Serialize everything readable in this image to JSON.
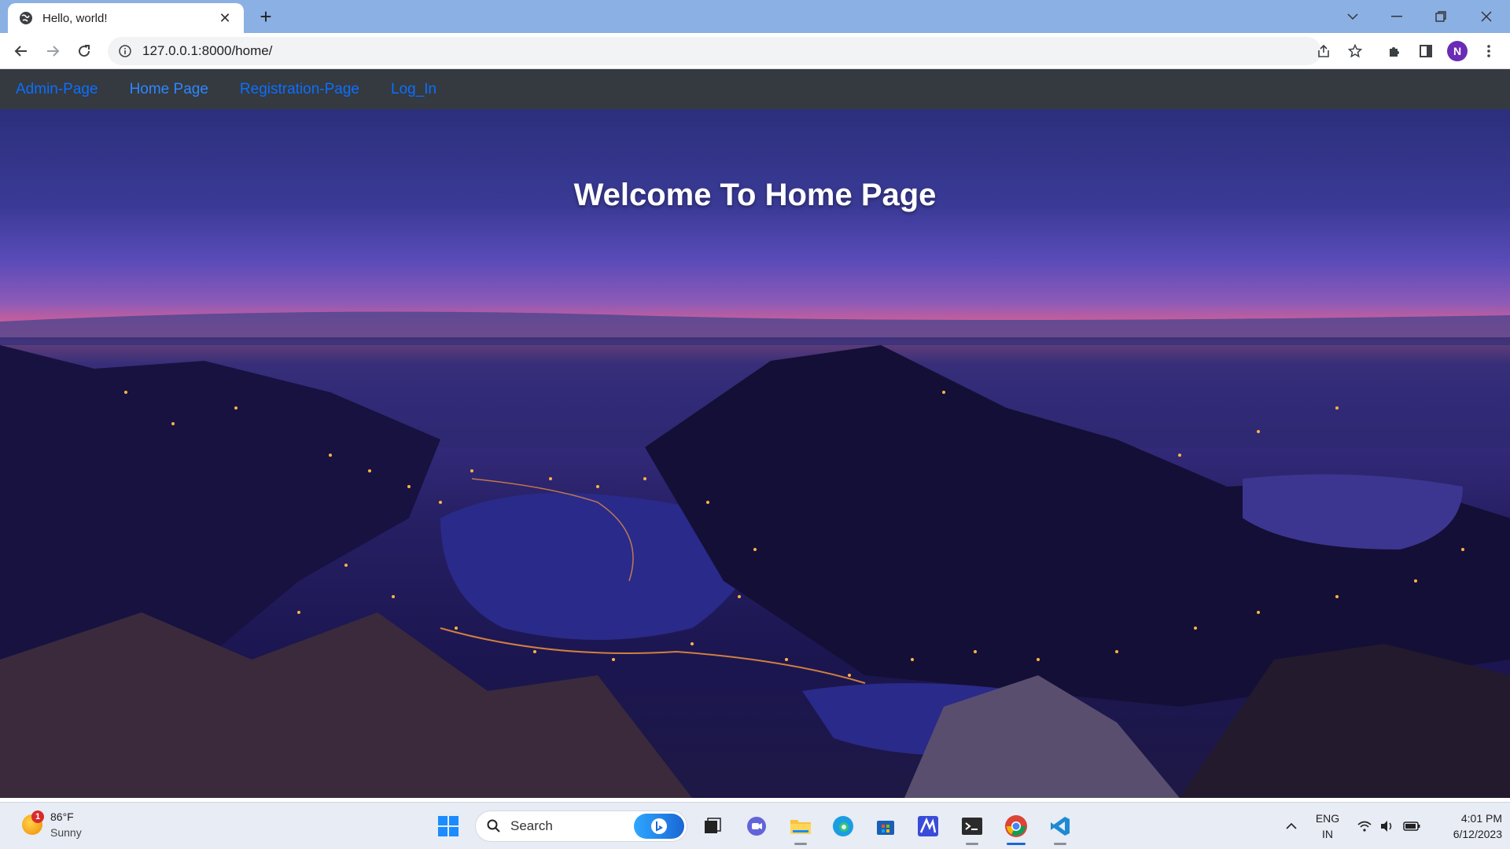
{
  "browser": {
    "tab_title": "Hello, world!",
    "url": "127.0.0.1:8000/home/",
    "profile_initial": "N"
  },
  "navbar": {
    "links": [
      {
        "label": "Admin-Page"
      },
      {
        "label": "Home Page"
      },
      {
        "label": "Registration-Page"
      },
      {
        "label": "Log_In"
      }
    ]
  },
  "hero": {
    "title": "Welcome To Home Page"
  },
  "taskbar": {
    "weather_temp": "86°F",
    "weather_desc": "Sunny",
    "weather_badge": "1",
    "search_label": "Search",
    "language": "ENG",
    "region": "IN",
    "time": "4:01 PM",
    "date": "6/12/2023"
  },
  "colors": {
    "navbar_bg": "#343a40",
    "link": "#0d6efd",
    "tabstrip": "#8bb0e4"
  }
}
